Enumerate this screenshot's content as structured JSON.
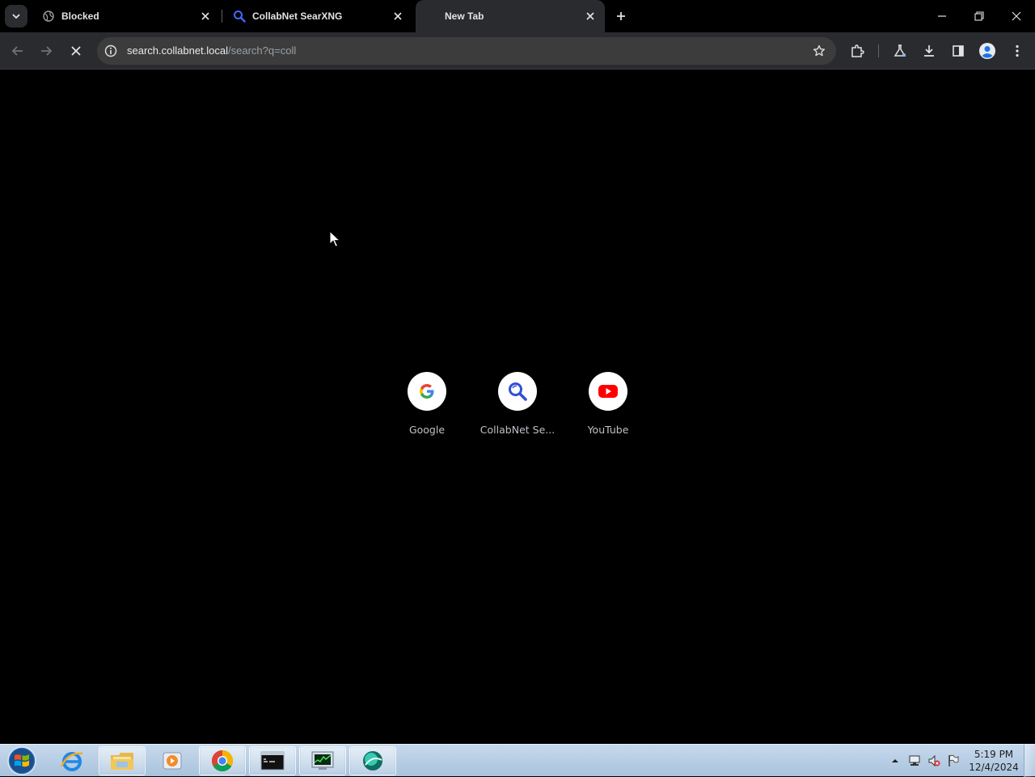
{
  "tabs": [
    {
      "title": "Blocked",
      "favicon": "globe-icon",
      "active": false
    },
    {
      "title": "CollabNet SearXNG",
      "favicon": "search-icon",
      "active": false
    },
    {
      "title": "New Tab",
      "favicon": "newtab-icon",
      "active": true
    }
  ],
  "omnibox": {
    "host": "search.collabnet.local",
    "path": "/search?q=coll"
  },
  "shortcuts": [
    {
      "label": "Google",
      "icon": "google-icon"
    },
    {
      "label": "CollabNet Se...",
      "icon": "search-icon"
    },
    {
      "label": "YouTube",
      "icon": "youtube-icon"
    }
  ],
  "taskbar": {
    "items": [
      "internet-explorer-icon",
      "file-explorer-icon",
      "media-player-icon",
      "chrome-icon",
      "command-prompt-icon",
      "task-manager-icon",
      "app-icon"
    ],
    "clock_time": "5:19 PM",
    "clock_date": "12/4/2024"
  },
  "colors": {
    "page_bg": "#000000",
    "toolbar_bg": "#2a2b2e",
    "omnibox_bg": "#3c3c3c",
    "taskbar_bg": "#b8cfe6",
    "youtube_red": "#ff0000",
    "searx_blue": "#3050d8"
  }
}
